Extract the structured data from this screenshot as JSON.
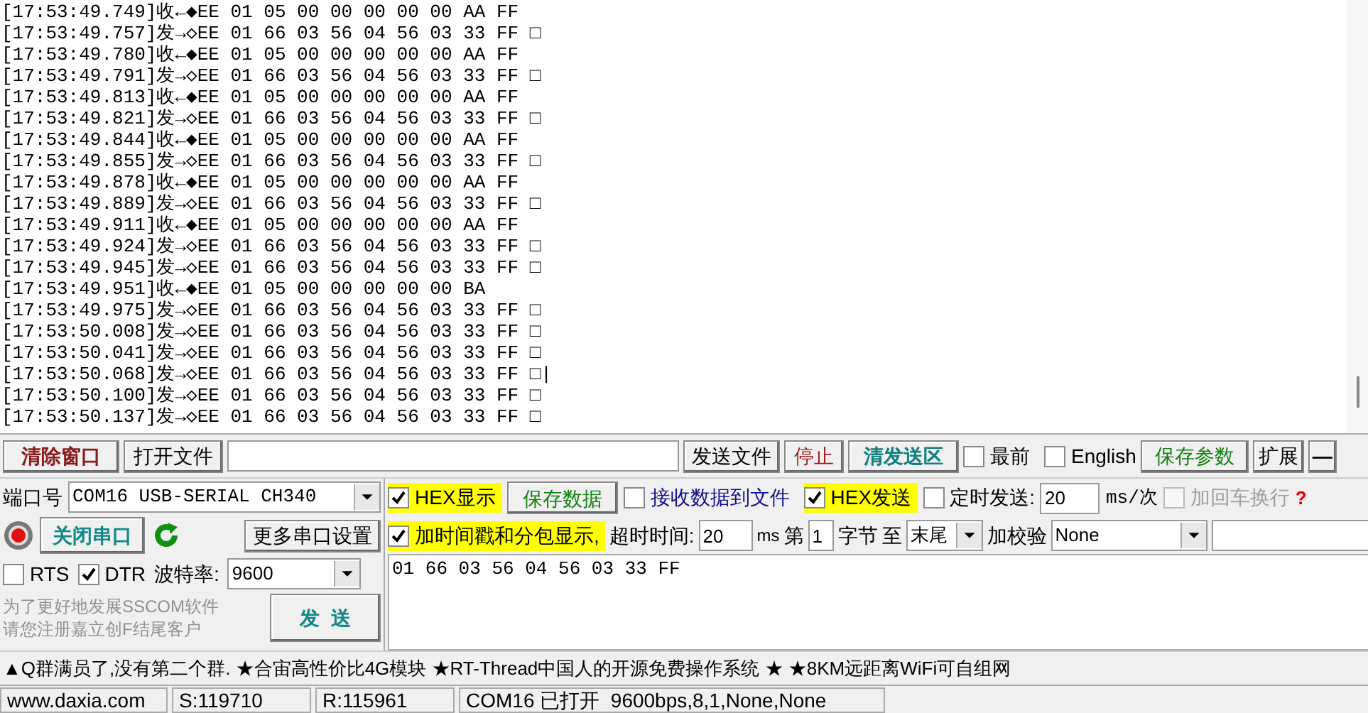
{
  "log": [
    {
      "text": "[17:53:49.749]收←◆EE 01 05 00 00 00 00 00 AA FF"
    },
    {
      "text": "[17:53:49.757]发→◇EE 01 66 03 56 04 56 03 33 FF □"
    },
    {
      "text": "[17:53:49.780]收←◆EE 01 05 00 00 00 00 00 AA FF"
    },
    {
      "text": "[17:53:49.791]发→◇EE 01 66 03 56 04 56 03 33 FF □"
    },
    {
      "text": "[17:53:49.813]收←◆EE 01 05 00 00 00 00 00 AA FF"
    },
    {
      "text": "[17:53:49.821]发→◇EE 01 66 03 56 04 56 03 33 FF □"
    },
    {
      "text": "[17:53:49.844]收←◆EE 01 05 00 00 00 00 00 AA FF"
    },
    {
      "text": "[17:53:49.855]发→◇EE 01 66 03 56 04 56 03 33 FF □"
    },
    {
      "text": "[17:53:49.878]收←◆EE 01 05 00 00 00 00 00 AA FF"
    },
    {
      "text": "[17:53:49.889]发→◇EE 01 66 03 56 04 56 03 33 FF □"
    },
    {
      "text": "[17:53:49.911]收←◆EE 01 05 00 00 00 00 00 AA FF"
    },
    {
      "text": "[17:53:49.924]发→◇EE 01 66 03 56 04 56 03 33 FF □"
    },
    {
      "text": "[17:53:49.945]发→◇EE 01 66 03 56 04 56 03 33 FF □"
    },
    {
      "text": "[17:53:49.951]收←◆EE 01 05 00 00 00 00 00 BA"
    },
    {
      "text": "[17:53:49.975]发→◇EE 01 66 03 56 04 56 03 33 FF □"
    },
    {
      "text": "[17:53:50.008]发→◇EE 01 66 03 56 04 56 03 33 FF □"
    },
    {
      "text": "[17:53:50.041]发→◇EE 01 66 03 56 04 56 03 33 FF □"
    },
    {
      "text": "[17:53:50.068]发→◇EE 01 66 03 56 04 56 03 33 FF □|"
    },
    {
      "text": "[17:53:50.100]发→◇EE 01 66 03 56 04 56 03 33 FF □"
    },
    {
      "text": "[17:53:50.137]发→◇EE 01 66 03 56 04 56 03 33 FF □"
    }
  ],
  "toolbar": {
    "clear": "清除窗口",
    "open_file": "打开文件",
    "send_file": "发送文件",
    "stop": "停止",
    "clear_send": "清发送区",
    "topmost": {
      "label": "最前",
      "checked": false
    },
    "english": {
      "label": "English",
      "checked": false
    },
    "save_params": "保存参数",
    "expand": "扩展",
    "minimize": "—"
  },
  "port": {
    "label": "端口号",
    "value": "COM16 USB-SERIAL CH340",
    "close": "关闭串口",
    "more": "更多串口设置",
    "rts": {
      "label": "RTS",
      "checked": false
    },
    "dtr": {
      "label": "DTR",
      "checked": true
    },
    "baud_label": "波特率:",
    "baud": "9600",
    "promo": [
      "为了更好地发展SSCOM软件",
      "请您注册嘉立创F结尾客户"
    ],
    "send": "发  送"
  },
  "options": {
    "hex_display": {
      "label": "HEX显示",
      "checked": true
    },
    "save_data": "保存数据",
    "recv_to_file": {
      "label": "接收数据到文件",
      "checked": false
    },
    "hex_send": {
      "label": "HEX发送",
      "checked": true
    },
    "timed_send": {
      "label": "定时发送:",
      "checked": false
    },
    "interval": "20",
    "interval_unit": "ms/次",
    "add_crlf": {
      "label": "加回车换行",
      "checked": false,
      "disabled": true
    },
    "help": "?",
    "timestamp": {
      "label": "加时间戳和分包显示,",
      "checked": true
    },
    "timeout_label": "超时时间:",
    "timeout": "20",
    "timeout_unit": "ms",
    "from_label": "第",
    "from": "1",
    "byte_label": "字节",
    "to_label": "至",
    "to": "末尾",
    "checksum_label": "加校验",
    "checksum": "None"
  },
  "send_text": "01 66 03 56 04 56 03 33 FF",
  "ticker": "▲Q群满员了,没有第二个群. ★合宙高性价比4G模块 ★RT-Thread中国人的开源免费操作系统 ★ ★8KM远距离WiFi可自组网",
  "status_bar": [
    "www.daxia.com",
    "S:119710",
    "R:115961",
    "COM16 已打开  9600bps,8,1,None,None"
  ]
}
